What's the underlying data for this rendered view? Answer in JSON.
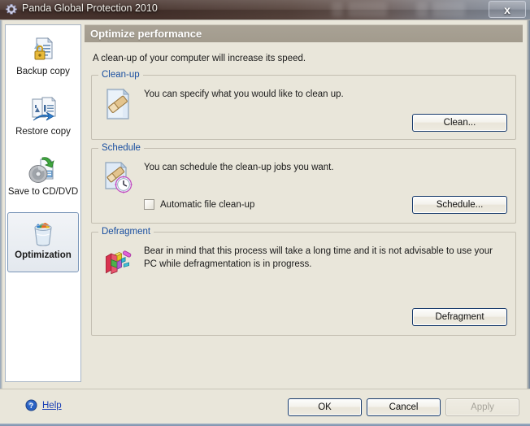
{
  "window": {
    "title": "Panda Global Protection 2010",
    "title_icon": "gear-icon",
    "close_label": "x"
  },
  "sidebar": {
    "items": [
      {
        "label": "Backup copy",
        "icon": "backup-copy-icon",
        "selected": false
      },
      {
        "label": "Restore copy",
        "icon": "restore-copy-icon",
        "selected": false
      },
      {
        "label": "Save to CD/DVD",
        "icon": "save-cd-dvd-icon",
        "selected": false
      },
      {
        "label": "Optimization",
        "icon": "optimization-icon",
        "selected": true
      }
    ]
  },
  "main": {
    "header": "Optimize performance",
    "description": "A clean-up of your computer will increase its speed.",
    "groups": [
      {
        "legend": "Clean-up",
        "icon": "cleanup-page-eraser-icon",
        "text": "You can specify what you would like to clean up.",
        "button": "Clean..."
      },
      {
        "legend": "Schedule",
        "icon": "schedule-clock-icon",
        "text": "You can schedule the clean-up jobs you want.",
        "checkbox_label": "Automatic file clean-up",
        "checkbox_checked": false,
        "button": "Schedule..."
      },
      {
        "legend": "Defragment",
        "icon": "defragment-blocks-icon",
        "text": "Bear in mind that this process will take a long time and it is not advisable to use your PC while defragmentation is in progress.",
        "button": "Defragment"
      }
    ]
  },
  "footer": {
    "help_icon": "help-question-icon",
    "help_label": "Help",
    "ok_label": "OK",
    "cancel_label": "Cancel",
    "apply_label": "Apply",
    "apply_disabled": true
  },
  "colors": {
    "panel_background": "#e9e6da",
    "header_band": "#a29b8d",
    "legend_blue": "#1a4fa0",
    "link_blue": "#1a3fb5",
    "button_border": "#173a6b",
    "selection_border": "#7a96b8"
  }
}
